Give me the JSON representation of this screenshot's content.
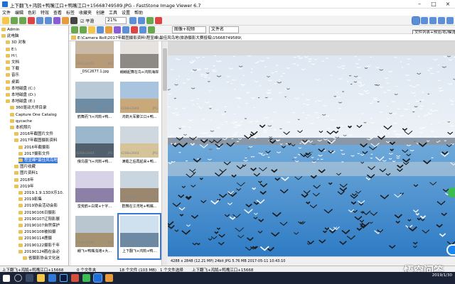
{
  "window": {
    "title": "上下翻飞+鸿鹄+鸭嘴江口+鸭嘴江口+15668749589.JPG - FastStone Image Viewer 6.7"
  },
  "menu": [
    "文件",
    "编辑",
    "色彩",
    "特效",
    "查看",
    "标签",
    "收藏夹",
    "创建",
    "工具",
    "设置",
    "帮助"
  ],
  "toolbar": {
    "zoom_checkbox_label": "平滑",
    "zoom_value": "21%",
    "sort_select": "图像+视频",
    "filter_select": "文件名"
  },
  "tooltip": "文件列表+预览/右/模式",
  "path": "E:\\Camera Roll\\2017年截图摄影资料\\程显峰\\最佳风鸟地\\旅游摄影大赛投稿\\15668749589\\",
  "tree": {
    "items": [
      {
        "label": "Admin",
        "indent": 0
      },
      {
        "label": "此电脑",
        "indent": 0
      },
      {
        "label": "3D 对象",
        "indent": 1
      },
      {
        "label": "E:\\",
        "indent": 1
      },
      {
        "label": "H:\\",
        "indent": 1
      },
      {
        "label": "文档",
        "indent": 1
      },
      {
        "label": "下载",
        "indent": 1
      },
      {
        "label": "音乐",
        "indent": 1
      },
      {
        "label": "桌面",
        "indent": 1
      },
      {
        "label": "本地磁盘 (C:)",
        "indent": 1
      },
      {
        "label": "本地磁盘 (D:)",
        "indent": 1
      },
      {
        "label": "本地磁盘 (E:)",
        "indent": 1
      },
      {
        "label": "360驱动大师目录",
        "indent": 2
      },
      {
        "label": "Capture One Catalog",
        "indent": 2
      },
      {
        "label": "qycache",
        "indent": 2
      },
      {
        "label": "本机照片",
        "indent": 2
      },
      {
        "label": "2016年截图片文件",
        "indent": 3
      },
      {
        "label": "2017年截图摄影资料",
        "indent": 3
      },
      {
        "label": "2016年截摄影",
        "indent": 4
      },
      {
        "label": "2017摄影文件",
        "indent": 4
      },
      {
        "label": "程显峰*最佳风鸟地",
        "indent": 4,
        "selected": true
      },
      {
        "label": "图片收藏",
        "indent": 3
      },
      {
        "label": "图片资料1",
        "indent": 3
      },
      {
        "label": "2018年",
        "indent": 3
      },
      {
        "label": "2019年",
        "indent": 3
      },
      {
        "label": "2019.1.9.13DX乐10.",
        "indent": 4
      },
      {
        "label": "2019影集",
        "indent": 4
      },
      {
        "label": "2019协会活动会影",
        "indent": 4
      },
      {
        "label": "20190106日摄影",
        "indent": 4
      },
      {
        "label": "20190107辽阳影展",
        "indent": 4
      },
      {
        "label": "20190107自然保护",
        "indent": 4
      },
      {
        "label": "20190108被拍摄",
        "indent": 4
      },
      {
        "label": "20190114鹿摄",
        "indent": 4
      },
      {
        "label": "20190122摄影千年",
        "indent": 4
      },
      {
        "label": "20190124鹳在会必",
        "indent": 4
      },
      {
        "label": "省摄影协会文化迷",
        "indent": 5
      }
    ]
  },
  "thumbnails": [
    {
      "caption": "_DSC2677.1.jpg",
      "dim": "3901x2655",
      "ext": "JPG",
      "sky": "#c9b9a5",
      "ground": "#b79b78"
    },
    {
      "caption": "翩翩起舞在鸟+鸿鹄海岸",
      "dim": "4288x2848",
      "ext": "JPG",
      "sky": "#e6e2df",
      "ground": "#8d8a86"
    },
    {
      "caption": "鹤舞而飞+鸿鹄+鸭...",
      "dim": "4288x2848",
      "ext": "JPG",
      "sky": "#b8c9d8",
      "ground": "#6f8ca5"
    },
    {
      "caption": "鸿鹄大军聚江口+鸭...",
      "dim": "4288x2848",
      "ext": "JPG",
      "sky": "#a9c4de",
      "ground": "#c9a87a"
    },
    {
      "caption": "俄鸟展飞+鸿鹄+鸭...",
      "dim": "4288x2848",
      "ext": "JPG",
      "sky": "#9ab7cc",
      "ground": "#51606c"
    },
    {
      "caption": "满载之后再起来+鸭...",
      "dim": "4288x2848",
      "ext": "JPG",
      "sky": "#cfd8de",
      "ground": "#d5c49a"
    },
    {
      "caption": "蛮荒鹤+白鹭+十字...",
      "dim": "4288x2848",
      "ext": "JPG",
      "sky": "#d7d2e6",
      "ground": "#8c7fa8"
    },
    {
      "caption": "群舞在江湾地+鸭嘴...",
      "dim": "4288x2848",
      "ext": "JPG",
      "sky": "#cad6df",
      "ground": "#9a876d"
    },
    {
      "caption": "翩飞+鸭嘴浅滩+大...",
      "dim": "4288x2848",
      "ext": "JPG",
      "sky": "#b9c6cf",
      "ground": "#a59270"
    },
    {
      "caption": "上下翻飞+鸿鹄+鸭...",
      "dim": "4288x2848",
      "ext": "JPG",
      "sky": "#cfe0ee",
      "ground": "#6c8aa3",
      "selected": true
    }
  ],
  "info": "4288 x 2848 (12.21 MP)  24bit  JPG  5.76 MB  2017-05-11 10:43:10",
  "status": {
    "left": "上下翻飞+鸿鹄+鸭嘴江口+15668",
    "middle": "0 个文件夹",
    "count": "18 个文件 (103 MB)",
    "selected": "1 个文件选择",
    "filename": "上下翻飞+鸿鹄+鸭嘴江口+15668"
  },
  "taskbar": {
    "time": "",
    "date": "2019/1/30"
  },
  "watermark": "悟空问答",
  "colors": {
    "accent": "#3a78d8",
    "sky": "#e9f1f8",
    "water": "#3f8ed0"
  }
}
